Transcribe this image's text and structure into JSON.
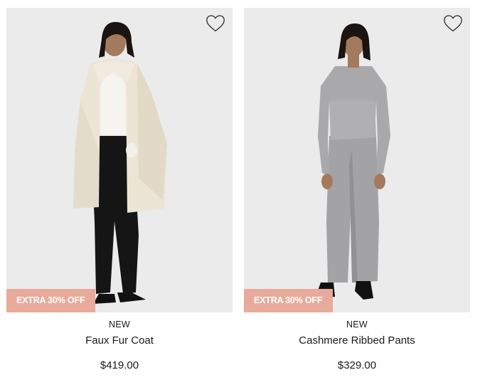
{
  "products": [
    {
      "tag": "NEW",
      "name": "Faux Fur Coat",
      "price": "$419.00",
      "promo": "EXTRA 30% OFF",
      "wishlist_icon": "heart-outline-icon"
    },
    {
      "tag": "NEW",
      "name": "Cashmere Ribbed Pants",
      "price": "$329.00",
      "promo": "EXTRA 30% OFF",
      "wishlist_icon": "heart-outline-icon"
    }
  ],
  "colors": {
    "photo_background": "#ebebeb",
    "promo_badge": "#e8ab9b",
    "text": "#1a1a1a"
  }
}
